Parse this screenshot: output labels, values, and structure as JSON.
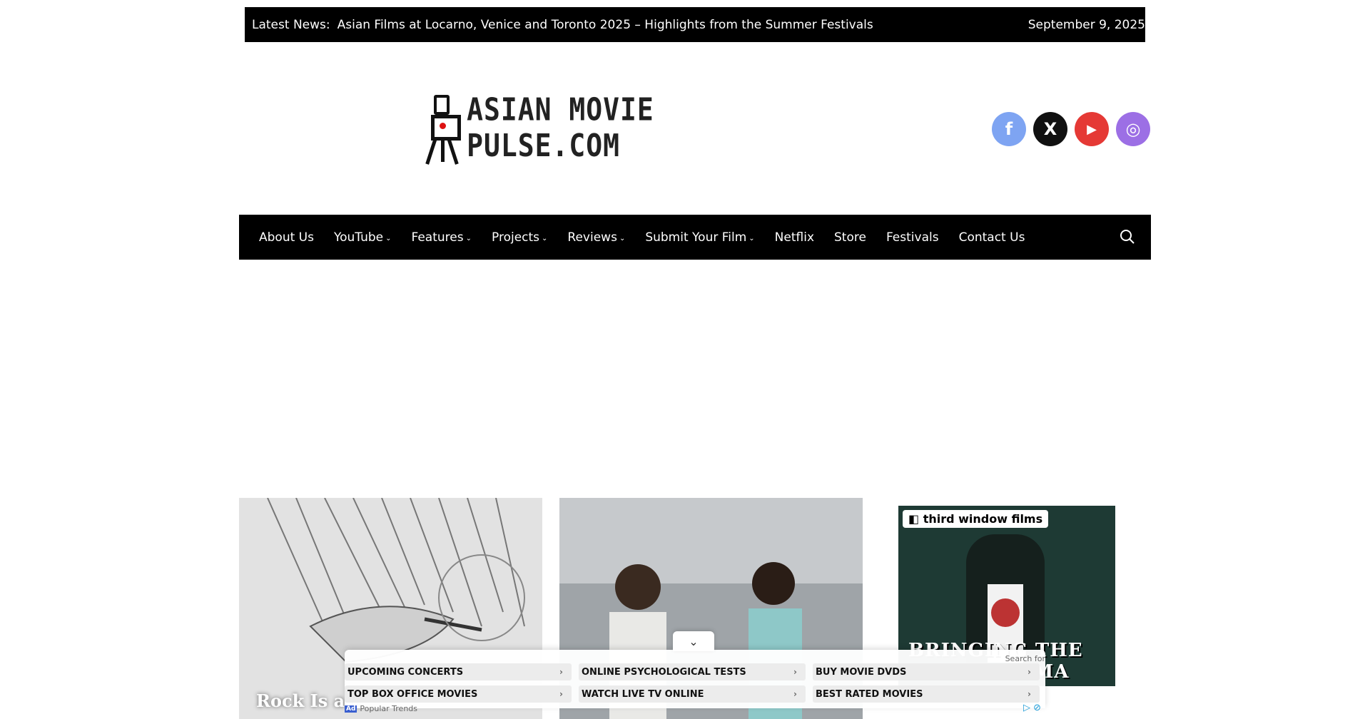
{
  "ticker": {
    "label": "Latest News:",
    "headline": "Asian Films at Locarno, Venice and Toronto 2025 – Highlights from the Summer Festivals",
    "date": "September 9, 2025"
  },
  "logo": {
    "text": "ASIAN MOVIE PULSE.COM",
    "accent": "#d11111"
  },
  "social": [
    {
      "name": "facebook",
      "icon": "f",
      "color": "#7ea4f2"
    },
    {
      "name": "x",
      "icon": "X",
      "color": "#111111"
    },
    {
      "name": "youtube",
      "icon": "▶",
      "color": "#e53935"
    },
    {
      "name": "instagram",
      "icon": "◎",
      "color": "#9c6fe5"
    }
  ],
  "nav": {
    "items": [
      {
        "label": "About Us",
        "dropdown": false
      },
      {
        "label": "YouTube",
        "dropdown": true
      },
      {
        "label": "Features",
        "dropdown": true
      },
      {
        "label": "Projects",
        "dropdown": true
      },
      {
        "label": "Reviews",
        "dropdown": true
      },
      {
        "label": "Submit Your Film",
        "dropdown": true
      },
      {
        "label": "Netflix",
        "dropdown": false
      },
      {
        "label": "Store",
        "dropdown": false
      },
      {
        "label": "Festivals",
        "dropdown": false
      },
      {
        "label": "Contact Us",
        "dropdown": false
      }
    ],
    "chevron": "⌄"
  },
  "cards": [
    {
      "title": "Rock Is a L"
    },
    {
      "title": ""
    }
  ],
  "sidead": {
    "brand": "third window films",
    "tagline": "BRINGING THE BEST CINEMA"
  },
  "bottom_ad": {
    "search_for": "Search for",
    "items": [
      "UPCOMING CONCERTS",
      "ONLINE PSYCHOLOGICAL TESTS",
      "BUY MOVIE DVDS",
      "TOP BOX OFFICE MOVIES",
      "WATCH LIVE TV ONLINE",
      "BEST RATED MOVIES"
    ],
    "ad_label": "Ad",
    "footer": "Popular Trends",
    "arrow": "›"
  }
}
